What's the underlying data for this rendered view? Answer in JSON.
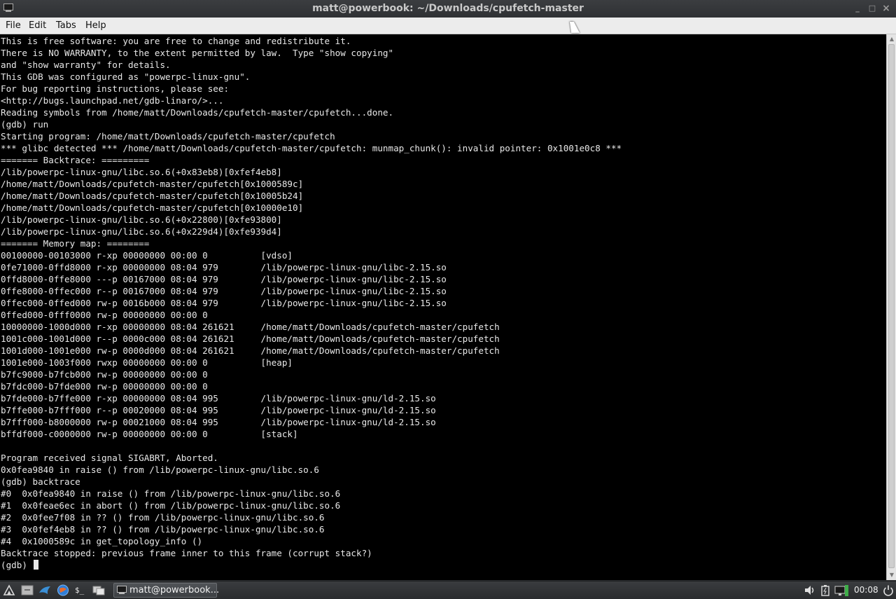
{
  "window": {
    "title": "matt@powerbook: ~/Downloads/cpufetch-master",
    "controls": {
      "minimize": "_",
      "maximize": "□",
      "close": "×"
    }
  },
  "menu": {
    "items": [
      {
        "label": "File"
      },
      {
        "label": "Edit"
      },
      {
        "label": "Tabs"
      },
      {
        "label": "Help"
      }
    ]
  },
  "terminal": {
    "lines": [
      "This is free software: you are free to change and redistribute it.",
      "There is NO WARRANTY, to the extent permitted by law.  Type \"show copying\"",
      "and \"show warranty\" for details.",
      "This GDB was configured as \"powerpc-linux-gnu\".",
      "For bug reporting instructions, please see:",
      "<http://bugs.launchpad.net/gdb-linaro/>...",
      "Reading symbols from /home/matt/Downloads/cpufetch-master/cpufetch...done.",
      "(gdb) run",
      "Starting program: /home/matt/Downloads/cpufetch-master/cpufetch",
      "*** glibc detected *** /home/matt/Downloads/cpufetch-master/cpufetch: munmap_chunk(): invalid pointer: 0x1001e0c8 ***",
      "======= Backtrace: =========",
      "/lib/powerpc-linux-gnu/libc.so.6(+0x83eb8)[0xfef4eb8]",
      "/home/matt/Downloads/cpufetch-master/cpufetch[0x1000589c]",
      "/home/matt/Downloads/cpufetch-master/cpufetch[0x10005b24]",
      "/home/matt/Downloads/cpufetch-master/cpufetch[0x10000e10]",
      "/lib/powerpc-linux-gnu/libc.so.6(+0x22800)[0xfe93800]",
      "/lib/powerpc-linux-gnu/libc.so.6(+0x229d4)[0xfe939d4]",
      "======= Memory map: ========",
      "00100000-00103000 r-xp 00000000 00:00 0          [vdso]",
      "0fe71000-0ffd8000 r-xp 00000000 08:04 979        /lib/powerpc-linux-gnu/libc-2.15.so",
      "0ffd8000-0ffe8000 ---p 00167000 08:04 979        /lib/powerpc-linux-gnu/libc-2.15.so",
      "0ffe8000-0ffec000 r--p 00167000 08:04 979        /lib/powerpc-linux-gnu/libc-2.15.so",
      "0ffec000-0ffed000 rw-p 0016b000 08:04 979        /lib/powerpc-linux-gnu/libc-2.15.so",
      "0ffed000-0fff0000 rw-p 00000000 00:00 0",
      "10000000-1000d000 r-xp 00000000 08:04 261621     /home/matt/Downloads/cpufetch-master/cpufetch",
      "1001c000-1001d000 r--p 0000c000 08:04 261621     /home/matt/Downloads/cpufetch-master/cpufetch",
      "1001d000-1001e000 rw-p 0000d000 08:04 261621     /home/matt/Downloads/cpufetch-master/cpufetch",
      "1001e000-1003f000 rwxp 00000000 00:00 0          [heap]",
      "b7fc9000-b7fcb000 rw-p 00000000 00:00 0",
      "b7fdc000-b7fde000 rw-p 00000000 00:00 0",
      "b7fde000-b7ffe000 r-xp 00000000 08:04 995        /lib/powerpc-linux-gnu/ld-2.15.so",
      "b7ffe000-b7fff000 r--p 00020000 08:04 995        /lib/powerpc-linux-gnu/ld-2.15.so",
      "b7fff000-b8000000 rw-p 00021000 08:04 995        /lib/powerpc-linux-gnu/ld-2.15.so",
      "bffdf000-c0000000 rw-p 00000000 00:00 0          [stack]",
      "",
      "Program received signal SIGABRT, Aborted.",
      "0x0fea9840 in raise () from /lib/powerpc-linux-gnu/libc.so.6",
      "(gdb) backtrace",
      "#0  0x0fea9840 in raise () from /lib/powerpc-linux-gnu/libc.so.6",
      "#1  0x0feae6ec in abort () from /lib/powerpc-linux-gnu/libc.so.6",
      "#2  0x0fee7f08 in ?? () from /lib/powerpc-linux-gnu/libc.so.6",
      "#3  0x0fef4eb8 in ?? () from /lib/powerpc-linux-gnu/libc.so.6",
      "#4  0x1000589c in get_topology_info ()",
      "Backtrace stopped: previous frame inner to this frame (corrupt stack?)"
    ],
    "prompt": "(gdb) "
  },
  "taskbar": {
    "launchers": [
      "menu-icon",
      "file-manager-icon",
      "browser-bird-icon",
      "browser-globe-icon",
      "terminal-icon",
      "show-desktop-icon"
    ],
    "task_label": "matt@powerbook...",
    "tray": [
      "volume-icon",
      "battery-icon",
      "network-icon"
    ],
    "clock": "00:08"
  }
}
